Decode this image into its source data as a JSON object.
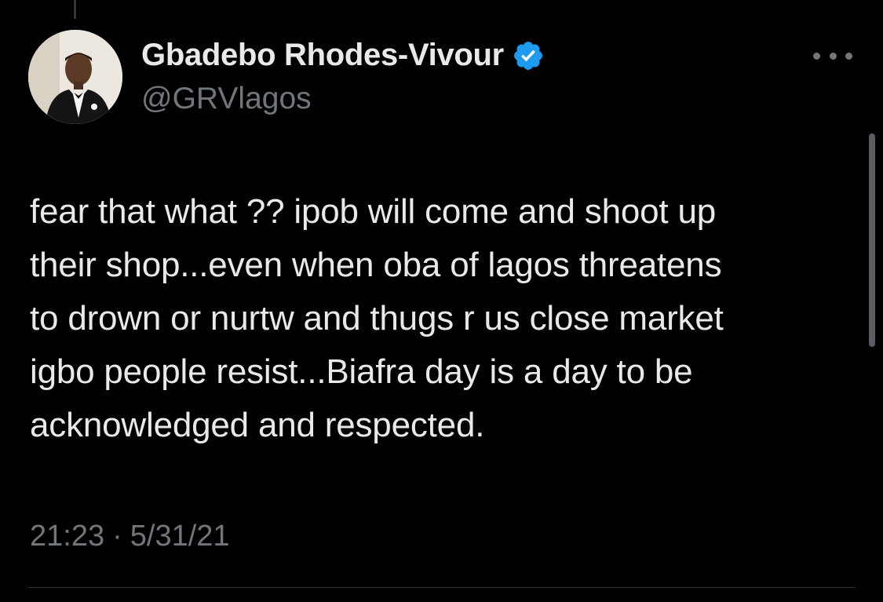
{
  "author": {
    "display_name": "Gbadebo Rhodes-Vivour",
    "handle": "@GRVlagos",
    "verified": true,
    "avatar_icon": "profile-photo"
  },
  "tweet": {
    "lines": [
      "fear that what ?? ipob will come and shoot up",
      "their shop...even when oba of lagos threatens",
      "to drown or nurtw and thugs r us close market",
      "igbo people resist...Biafra day is a day to be",
      "acknowledged and respected."
    ],
    "time": "21:23",
    "separator": "·",
    "date": "5/31/21"
  },
  "icons": {
    "verified": "verified-badge-icon",
    "more": "more-options-icon"
  },
  "colors": {
    "background": "#000000",
    "primary_text": "#e7e9ea",
    "secondary_text": "#71767b",
    "verified_blue": "#1d9bf0"
  }
}
